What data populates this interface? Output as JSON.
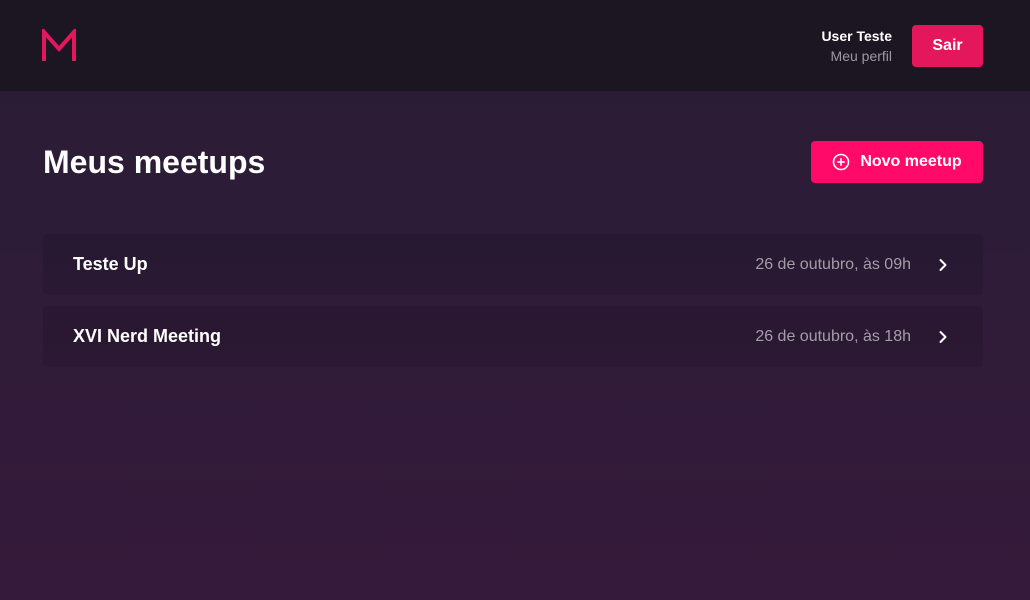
{
  "colors": {
    "brand": "#f94d6a",
    "accent": "#ff0a69",
    "logout_button": "#e5175c",
    "header_bg": "#1c1623"
  },
  "header": {
    "logo_icon": "logo-m-icon",
    "user_name": "User Teste",
    "profile_link": "Meu perfil",
    "logout_label": "Sair"
  },
  "main": {
    "title": "Meus meetups",
    "new_button": {
      "icon": "add-circle-icon",
      "label": "Novo meetup"
    },
    "meetups": [
      {
        "title": "Teste Up",
        "date": "26 de outubro, às 09h",
        "icon": "chevron-right-icon"
      },
      {
        "title": "XVI Nerd Meeting",
        "date": "26 de outubro, às 18h",
        "icon": "chevron-right-icon"
      }
    ]
  }
}
